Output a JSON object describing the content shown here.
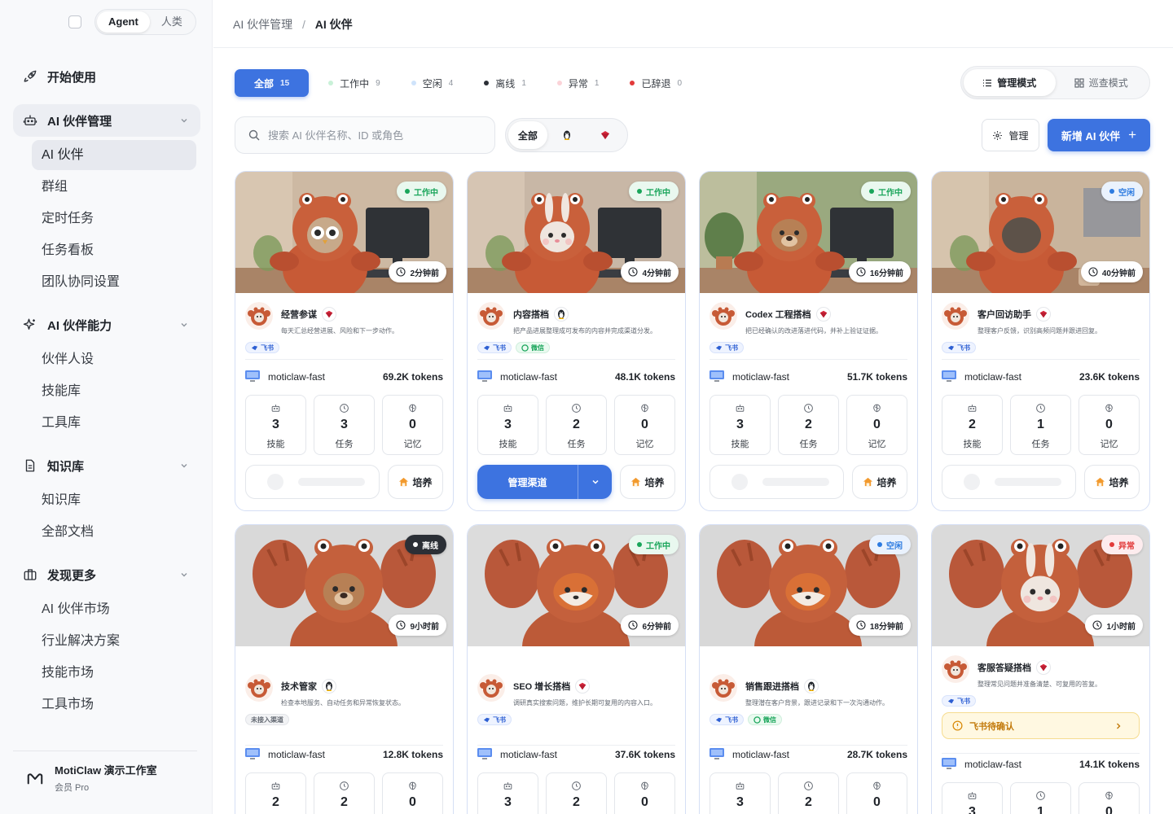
{
  "sidebar": {
    "toggle": {
      "agent": "Agent",
      "human": "人类"
    },
    "start": "开始使用",
    "sections": [
      {
        "label": "AI 伙伴管理",
        "items": [
          "AI 伙伴",
          "群组",
          "定时任务",
          "任务看板",
          "团队协同设置"
        ]
      },
      {
        "label": "AI 伙伴能力",
        "items": [
          "伙伴人设",
          "技能库",
          "工具库"
        ]
      },
      {
        "label": "知识库",
        "items": [
          "知识库",
          "全部文档"
        ]
      },
      {
        "label": "发现更多",
        "items": [
          "AI 伙伴市场",
          "行业解决方案",
          "技能市场",
          "工具市场"
        ]
      }
    ],
    "workspace": {
      "name": "MotiClaw 演示工作室",
      "plan": "会员 Pro"
    }
  },
  "breadcrumb": {
    "parent": "AI 伙伴管理",
    "sep": "/",
    "current": "AI 伙伴"
  },
  "filters": [
    {
      "label": "全部",
      "count": "15",
      "color": ""
    },
    {
      "label": "工作中",
      "count": "9",
      "color": "#c9f1d8"
    },
    {
      "label": "空闲",
      "count": "4",
      "color": "#cfe3fb"
    },
    {
      "label": "离线",
      "count": "1",
      "color": "#2b2f36"
    },
    {
      "label": "异常",
      "count": "1",
      "color": "#fbd3d8"
    },
    {
      "label": "已辞退",
      "count": "0",
      "color": "#e23a3a"
    }
  ],
  "view_modes": {
    "manage": "管理模式",
    "patrol": "巡查模式"
  },
  "search": {
    "placeholder": "搜索 AI 伙伴名称、ID 或角色"
  },
  "platform_filter": {
    "all": "全部"
  },
  "buttons": {
    "manage": "管理",
    "add": "新增 AI 伙伴",
    "plus": "+"
  },
  "labels": {
    "skills": "技能",
    "tasks": "任务",
    "memory": "记忆",
    "manage_channel": "管理渠道",
    "train": "培养"
  },
  "colors": {
    "accent": "#3d73e0",
    "working": "#19a55a",
    "idle": "#2d7be0",
    "offline": "#2b2f36",
    "error": "#e23a3a"
  },
  "cards": [
    {
      "status": "工作中",
      "status_key": "working",
      "ago": "2分钟前",
      "name": "经营参谋",
      "platform_icon": "feishu-icon",
      "desc": "每天汇总经营进展、风险和下一步动作。",
      "tags": [
        "飞书"
      ],
      "model": "moticlaw-fast",
      "tokens": "69.2K tokens",
      "skills": "3",
      "tasks": "3",
      "memory": "0",
      "action": "empty"
    },
    {
      "status": "工作中",
      "status_key": "working",
      "ago": "4分钟前",
      "name": "内容搭档",
      "platform_icon": "qq-icon",
      "desc": "把产品进展整理成可发布的内容并完成渠道分发。",
      "tags": [
        "飞书",
        "微信"
      ],
      "model": "moticlaw-fast",
      "tokens": "48.1K tokens",
      "skills": "3",
      "tasks": "2",
      "memory": "0",
      "action": "manage"
    },
    {
      "status": "工作中",
      "status_key": "working",
      "ago": "16分钟前",
      "name": "Codex 工程搭档",
      "platform_icon": "feishu-icon",
      "desc": "把已经确认的改进落进代码，并补上验证证据。",
      "tags": [
        "飞书"
      ],
      "model": "moticlaw-fast",
      "tokens": "51.7K tokens",
      "skills": "3",
      "tasks": "2",
      "memory": "0",
      "action": "empty"
    },
    {
      "status": "空闲",
      "status_key": "idle",
      "ago": "40分钟前",
      "name": "客户回访助手",
      "platform_icon": "feishu-icon",
      "desc": "整理客户反馈，识别高频问题并跟进回复。",
      "tags": [
        "飞书"
      ],
      "model": "moticlaw-fast",
      "tokens": "23.6K tokens",
      "skills": "2",
      "tasks": "1",
      "memory": "0",
      "action": "empty"
    },
    {
      "status": "离线",
      "status_key": "offline",
      "ago": "9小时前",
      "name": "技术管家",
      "platform_icon": "qq-icon",
      "desc": "检查本地服务、自动任务和异常恢复状态。",
      "tags": [
        "未接入渠道"
      ],
      "model": "moticlaw-fast",
      "tokens": "12.8K tokens",
      "skills": "2",
      "tasks": "2",
      "memory": "0",
      "action": "none"
    },
    {
      "status": "工作中",
      "status_key": "working",
      "ago": "6分钟前",
      "name": "SEO 增长搭档",
      "platform_icon": "feishu-icon",
      "desc": "调研真实搜索问题，维护长期可复用的内容入口。",
      "tags": [
        "飞书"
      ],
      "model": "moticlaw-fast",
      "tokens": "37.6K tokens",
      "skills": "3",
      "tasks": "2",
      "memory": "0",
      "action": "none"
    },
    {
      "status": "空闲",
      "status_key": "idle",
      "ago": "18分钟前",
      "name": "销售跟进搭档",
      "platform_icon": "qq-icon",
      "desc": "整理潜在客户背景，跟进记录和下一次沟通动作。",
      "tags": [
        "飞书",
        "微信"
      ],
      "model": "moticlaw-fast",
      "tokens": "28.7K tokens",
      "skills": "3",
      "tasks": "2",
      "memory": "0",
      "action": "none"
    },
    {
      "status": "异常",
      "status_key": "error",
      "ago": "1小时前",
      "name": "客服答疑搭档",
      "platform_icon": "feishu-icon",
      "desc": "整理常见问题并准备清楚、可复用的答复。",
      "tags": [
        "飞书"
      ],
      "alert": "飞书待确认",
      "model": "moticlaw-fast",
      "tokens": "14.1K tokens",
      "skills": "3",
      "tasks": "1",
      "memory": "0",
      "action": "none"
    }
  ]
}
